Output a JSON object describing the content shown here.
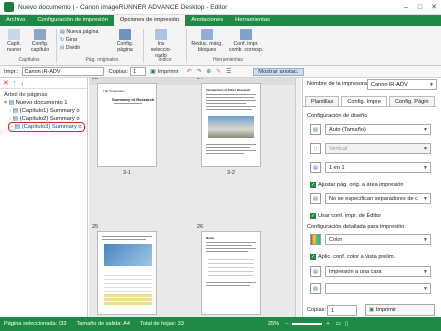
{
  "window": {
    "title": "Nuevo documento | - Canon imageRUNNER ADVANCE Desktop - Editor",
    "min": "–",
    "max": "□",
    "close": "✕"
  },
  "tabs": [
    "Archivo",
    "Configuración de impresión",
    "Opciones de impresión",
    "Anotaciones",
    "Herramientas"
  ],
  "ribbon": {
    "capit_nuevo": "Capít. nuevo",
    "config_capitulo": "Config. capítulo",
    "nueva_pagina": "Nueva página",
    "girar": "Girar",
    "dividir": "Dividir",
    "config_pagina": "Config. página",
    "ins_seleccionado": "Ins seleccio-nado",
    "reduc_marg": "Reduc. márg. bloques",
    "conf_impr_comb": "Conf. impr. comb. corresp.",
    "groups": [
      "Capítulos",
      "Pág. originales",
      "Índice",
      "Herramientas"
    ]
  },
  "toolbar": {
    "impr_label": "Impr.:",
    "printer": "Canon iR-ADV",
    "copies_label": "Copias:",
    "copies": "1",
    "imprimir": "Imprimir",
    "mostrar": "Mostrar anotac."
  },
  "left": {
    "header": "Árbol de páginas",
    "items": [
      "Nuevo documento 1",
      "(Capítulo1) Summary o",
      "(Capítulo2) Summary o",
      "(Capítulo3) Summary o"
    ]
  },
  "center": {
    "pages": [
      {
        "num": "23",
        "label": "3-1",
        "title": "The Corporation",
        "heading": "Summary of Research"
      },
      {
        "num": "24",
        "label": "3-2",
        "title": "Introduction of Other Research"
      },
      {
        "num": "25",
        "label": "",
        "title": ""
      },
      {
        "num": "26",
        "label": "",
        "title": "Name"
      }
    ]
  },
  "right": {
    "printer_label": "Nombre de la impresora:",
    "printer": "Canon iR-ADV",
    "tabs": [
      "Plantillas",
      "Config. Impre",
      "Config. Págin"
    ],
    "layout_header": "Configuración de diseño",
    "layout_value": "Auto (Tamaño)",
    "vertical": "Vertical",
    "one_in_one": "1 en 1",
    "ajustar": "Ajustar pág. orig. a área impresión",
    "no_sep": "No se especifican separadores de c",
    "usar_conf": "Usar conf. impr. de Editor",
    "detallada_header": "Configuración detallada para impresión",
    "color": "Color",
    "aplic": "Aplic. conf. color a vista prelim.",
    "impresion": "Impresión a una cara",
    "copias_label": "Copias:",
    "copias": "1",
    "imprimir": "Imprimir"
  },
  "status": {
    "seleccionada": "Página seleccionada: /33",
    "tamano": "Tamaño de salida: A4",
    "total": "Total de hojas: 33",
    "zoom": "25%"
  }
}
